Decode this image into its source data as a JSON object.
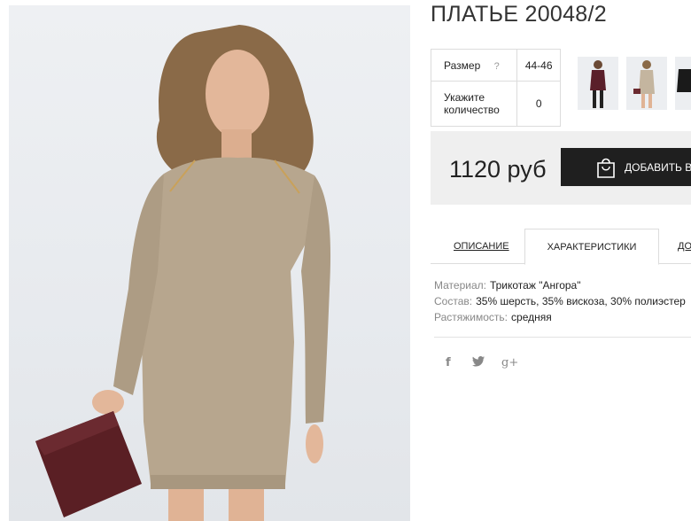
{
  "product": {
    "title": "ПЛАТЬЕ 20048/2",
    "image_alt": "Model in beige knit dress holding burgundy clutch"
  },
  "size_table": {
    "size_label": "Размер",
    "size_help": "?",
    "size_value": "44-46",
    "qty_label_line1": "Укажите",
    "qty_label_line2": "количество",
    "qty_value": "0"
  },
  "thumbnails": [
    {
      "name": "thumb-burgundy-dress"
    },
    {
      "name": "thumb-beige-dress"
    },
    {
      "name": "thumb-black-dress"
    }
  ],
  "purchase": {
    "price": "1120 руб",
    "add_button_label": "ДОБАВИТЬ В"
  },
  "tabs": [
    {
      "label": "ОПИСАНИЕ",
      "active": false
    },
    {
      "label": "ХАРАКТЕРИСТИКИ",
      "active": true
    },
    {
      "label": "ДО",
      "active": false
    }
  ],
  "characteristics": [
    {
      "key": "Материал:",
      "value": "Трикотаж \"Ангора\""
    },
    {
      "key": "Состав:",
      "value": "35% шерсть, 35% вискоза, 30% полиэстер"
    },
    {
      "key": "Растяжимость:",
      "value": "средняя"
    }
  ],
  "social": {
    "facebook": "f",
    "twitter": "🐦",
    "googleplus": "g+"
  },
  "colors": {
    "dress": "#b7a68e",
    "clutch": "#5a1f24",
    "button_bg": "#1f1f1f",
    "price_bg": "#efefef"
  }
}
